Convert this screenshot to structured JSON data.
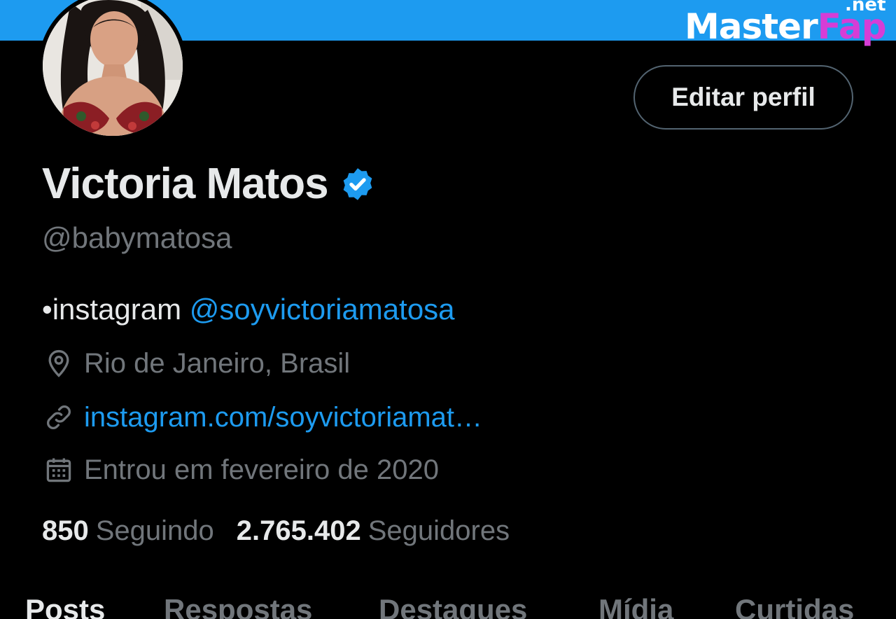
{
  "watermark": {
    "master": "Master",
    "fap": "Fap",
    "net": ".net"
  },
  "profile": {
    "edit_button": "Editar perfil",
    "name": "Victoria Matos",
    "handle": "@babymatosa",
    "bio_prefix": "•instagram ",
    "bio_mention": "@soyvictoriamatosa",
    "location": "Rio de Janeiro, Brasil",
    "website": "instagram.com/soyvictoriamat…",
    "joined": "Entrou em fevereiro de 2020",
    "following_count": "850",
    "following_label": "Seguindo",
    "followers_count": "2.765.402",
    "followers_label": "Seguidores"
  },
  "tabs": [
    {
      "label": "Posts",
      "active": true
    },
    {
      "label": "Respostas",
      "active": false
    },
    {
      "label": "Destaques",
      "active": false
    },
    {
      "label": "Mídia",
      "active": false
    },
    {
      "label": "Curtidas",
      "active": false
    }
  ],
  "icons": {
    "location": "location-pin-icon",
    "link": "link-icon",
    "calendar": "calendar-icon",
    "verified": "verified-badge-icon"
  },
  "colors": {
    "background": "#000000",
    "banner": "#1d9bf0",
    "accent": "#1d9bf0",
    "text_primary": "#e7e9ea",
    "text_secondary": "#71767b",
    "border": "#536471"
  }
}
